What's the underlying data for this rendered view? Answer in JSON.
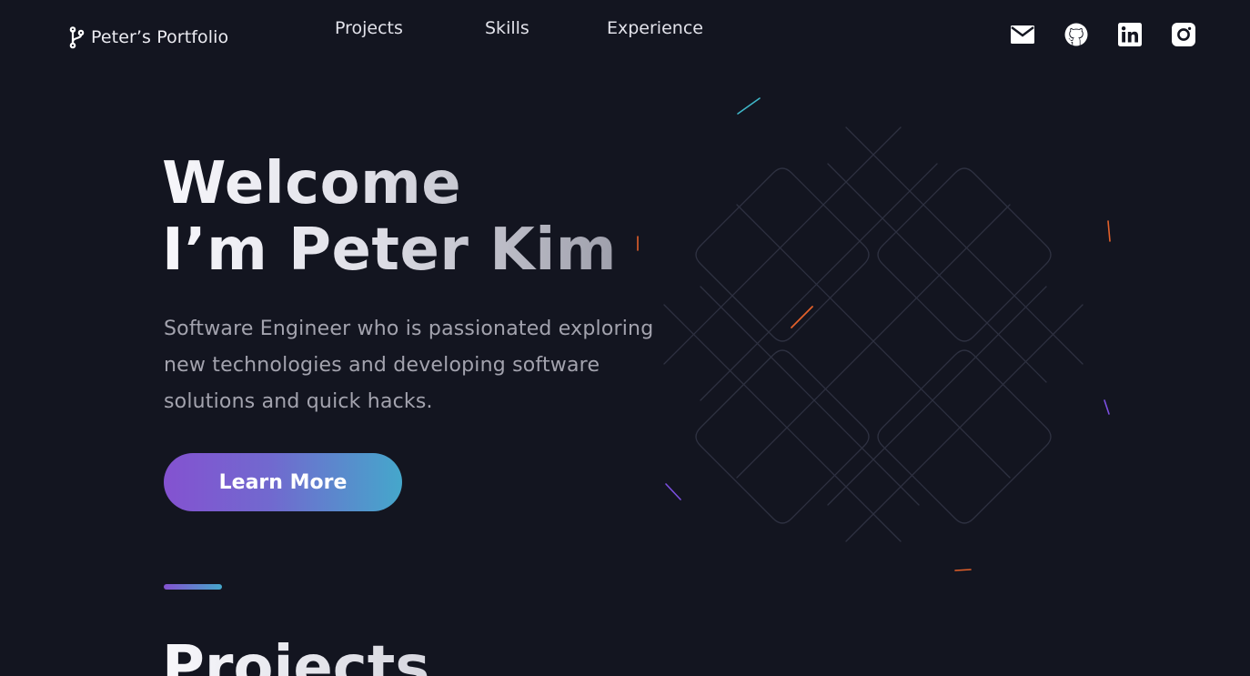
{
  "header": {
    "logo_text": "Peter’s Portfolio",
    "nav": [
      {
        "label": "Projects"
      },
      {
        "label": "Skills"
      },
      {
        "label": "Experience"
      }
    ],
    "socials": [
      {
        "icon": "mail-icon"
      },
      {
        "icon": "github-icon"
      },
      {
        "icon": "linkedin-icon"
      },
      {
        "icon": "instagram-icon"
      }
    ]
  },
  "hero": {
    "title_line1": "Welcome",
    "title_line2": "I’m Peter Kim",
    "subtitle": "Software Engineer who is passionated exploring new technologies and developing software solutions and quick hacks.",
    "cta_label": "Learn More"
  },
  "sections": {
    "projects_heading": "Projects"
  },
  "colors": {
    "background": "#131520",
    "accent_purple": "#8452d0",
    "accent_cyan": "#45a7cb",
    "spark_orange": "#e2602a",
    "spark_violet": "#7b4fe0",
    "spark_teal": "#3fb6c8"
  }
}
